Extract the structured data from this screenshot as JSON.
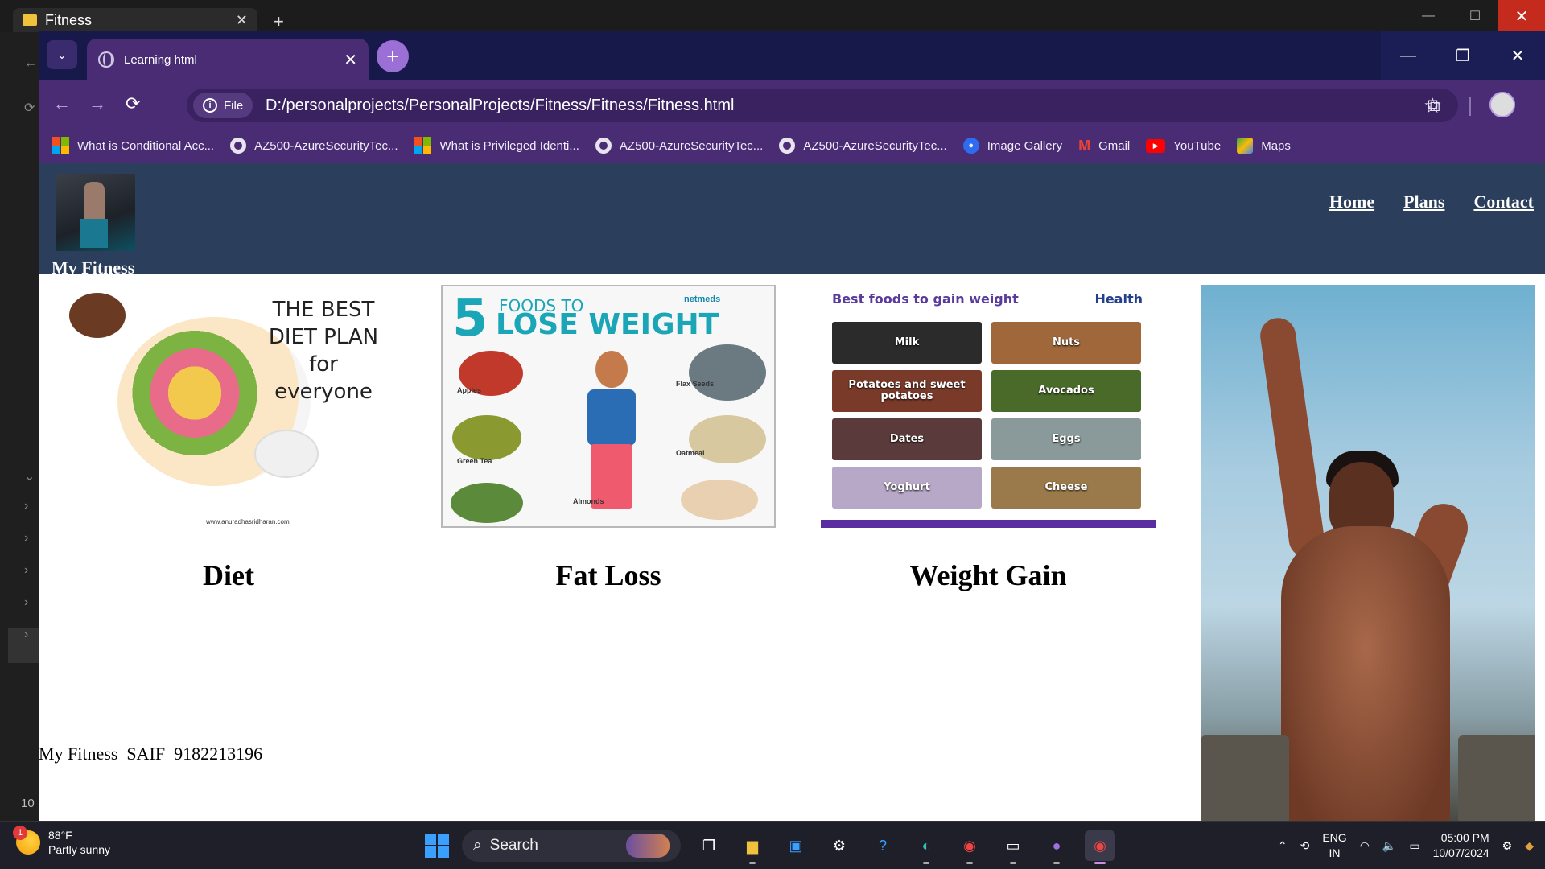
{
  "explorer": {
    "tab_title": "Fitness",
    "sidebar_number": "10"
  },
  "browser": {
    "tab_title": "Learning html",
    "site_chip": "File",
    "url": "D:/personalprojects/PersonalProjects/Fitness/Fitness/Fitness.html",
    "bookmarks": [
      {
        "label": "What is Conditional Acc...",
        "icon": "microsoft-icon"
      },
      {
        "label": "AZ500-AzureSecurityTec...",
        "icon": "globe-icon"
      },
      {
        "label": "What is Privileged Identi...",
        "icon": "microsoft-icon"
      },
      {
        "label": "AZ500-AzureSecurityTec...",
        "icon": "globe-icon"
      },
      {
        "label": "AZ500-AzureSecurityTec...",
        "icon": "globe-icon"
      },
      {
        "label": "Image Gallery",
        "icon": "image-gallery-icon"
      },
      {
        "label": "Gmail",
        "icon": "gmail-icon"
      },
      {
        "label": "YouTube",
        "icon": "youtube-icon"
      },
      {
        "label": "Maps",
        "icon": "maps-icon"
      }
    ]
  },
  "site": {
    "brand": "My Fitness",
    "nav": [
      "Home",
      "Plans",
      "Contact"
    ],
    "cards": [
      {
        "label": "Diet"
      },
      {
        "label": "Fat Loss"
      },
      {
        "label": "Weight Gain"
      }
    ],
    "diet_image": {
      "headline": "THE BEST DIET PLAN for everyone",
      "credit": "www.anuradhasridharan.com"
    },
    "fatloss_image": {
      "number": "5",
      "title_top": "FOODS TO",
      "title_bottom": "LOSE WEIGHT",
      "brand": "netmeds",
      "foods": [
        "Apples",
        "Flax Seeds",
        "Green Tea",
        "Oatmeal",
        "Almonds"
      ]
    },
    "weightgain_image": {
      "heading": "Best foods to gain weight",
      "brand": "Health",
      "foods": [
        "Milk",
        "Nuts",
        "Potatoes and sweet potatoes",
        "Avocados",
        "Dates",
        "Eggs",
        "Yoghurt",
        "Cheese"
      ]
    },
    "footer": "My Fitness  SAIF  9182213196"
  },
  "taskbar": {
    "weather_temp": "88°F",
    "weather_desc": "Partly sunny",
    "weather_badge": "1",
    "search_placeholder": "Search",
    "lang_top": "ENG",
    "lang_bottom": "IN",
    "time": "05:00 PM",
    "date": "10/07/2024"
  }
}
